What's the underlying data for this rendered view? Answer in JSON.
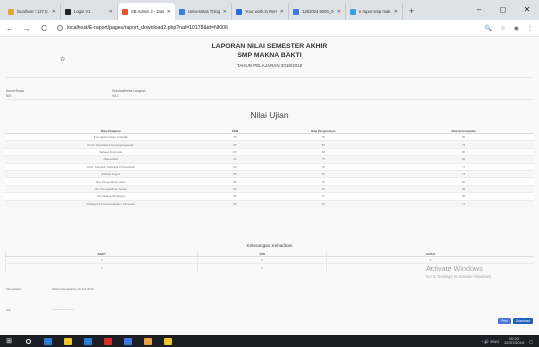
{
  "browser": {
    "tabs": [
      {
        "label": "localhost / 127.0.",
        "color": "#e8a33d"
      },
      {
        "label": "Login V1",
        "color": "#222222"
      },
      {
        "label": "SB Admin 2 - Das",
        "color": "#e0572b",
        "active": true
      },
      {
        "label": "Universitas Trilog",
        "color": "#3a7bd5"
      },
      {
        "label": "Your work in Rem",
        "color": "#2a6ad8"
      },
      {
        "label": "1252024 5000_01",
        "color": "#3d7ae6"
      },
      {
        "label": "e rapor smp mak",
        "color": "#3ba0e6"
      }
    ],
    "new_tab": "+",
    "window_controls": [
      "–",
      "◻",
      "✕"
    ],
    "nav": [
      "←",
      "→",
      "C"
    ],
    "url": "localhost/E-raport/pages/raport_download2.php?nal=10178&id=NI006",
    "addr_icons": [
      "🔍",
      "☆",
      "◉",
      "⋮"
    ]
  },
  "report": {
    "title1": "LAPORAN NILAI SEMESTER AKHIR",
    "title2": "SMP MAKNA BAKTI",
    "year": "TAHUN PELAJARAN 2018/2019",
    "info_left_label": "Nama Siswa",
    "info_left_value": "NIS",
    "info_right_label": "Sekolah/Kelas Langkah",
    "info_right_value": "VII-1",
    "grades_heading": "Nilai Ujian",
    "grades_columns": [
      "Mata Pelajaran",
      "KKM",
      "Nilai Pengetahuan",
      "Nilai Keterampilan"
    ],
    "grades_rows": [
      [
        "Ilmu Agama Islam & Ibadah",
        "75",
        "75",
        "80"
      ],
      [
        "Pend. Pancasila & Kewarganegaraan",
        "80",
        "80",
        "75"
      ],
      [
        "Bahasa Indonesia",
        "80",
        "80",
        "80"
      ],
      [
        "Matematika",
        "80",
        "75",
        "80"
      ],
      [
        "Pend. Jasmani, Olahraga & Kesehatan",
        "80",
        "75",
        "77"
      ],
      [
        "Bahasa Inggris",
        "80",
        "75",
        "77"
      ],
      [
        "Ilmu Pengetahuan Alam",
        "80",
        "75",
        "80"
      ],
      [
        "Ilmu Pengetahuan Sosial",
        "80",
        "75",
        "80"
      ],
      [
        "Seni Budaya/Prakarya",
        "80",
        "77",
        "80"
      ],
      [
        "Prakarya & Kewirausahaan / Komputer",
        "80",
        "75",
        "77"
      ]
    ],
    "attendance_heading": "Keterangan Kehadiran",
    "attendance_columns": [
      "SAKIT",
      "IZIN",
      "ALPHA"
    ],
    "attendance_rows": [
      [
        "0",
        "0",
        "0"
      ],
      [
        "0",
        "0",
        "0"
      ]
    ],
    "foot_left": "Mengetahui",
    "foot_mid": "Wali Kelas",
    "foot_mid2": "Jakarta, 20 Juli 2019",
    "foot_sign": "NIP",
    "foot_sign_line": "_____________",
    "watermark_title": "Activate Windows",
    "watermark_sub": "Go to Settings to activate Windows.",
    "btn_print": "Print",
    "btn_download": "Download",
    "logo_icon": "school-logo"
  },
  "taskbar": {
    "start": "⊞",
    "tray": "^  🔊  ENG",
    "time": "09:22",
    "date": "22/07/2019",
    "icons": [
      "#2b7fd8",
      "#f0c52c",
      "#2b7fd8",
      "#d93025",
      "#3d7ae6",
      "#e8a33d",
      "#f0c52c"
    ]
  }
}
